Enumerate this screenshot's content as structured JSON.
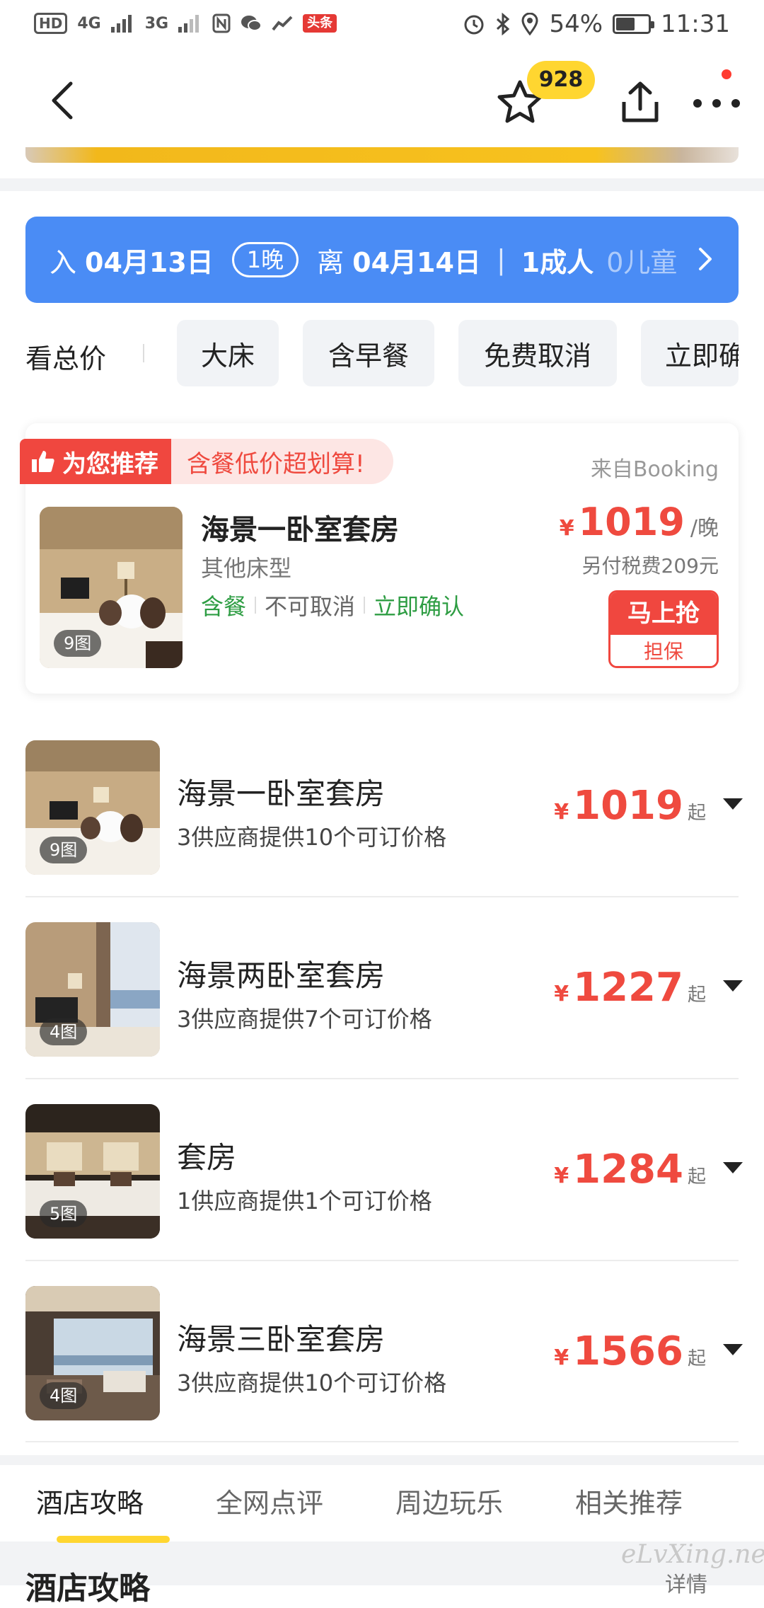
{
  "status_bar": {
    "hd": "HD",
    "sim1": "4G",
    "sim2": "3G",
    "news_badge": "头条",
    "battery_text": "54%",
    "battery_level": 0.54,
    "time": "11:31"
  },
  "nav": {
    "favorite_count": "928"
  },
  "date_bar": {
    "checkin_prefix": "入",
    "checkin_date": "04月13日",
    "nights": "1晚",
    "checkout_prefix": "离",
    "checkout_date": "04月14日",
    "separator": "|",
    "adults": "1成人",
    "children": "0儿童"
  },
  "filters": {
    "total_price_label": "看总价",
    "chips": [
      "大床",
      "含早餐",
      "免费取消",
      "立即确认"
    ]
  },
  "recommended": {
    "tag_label": "为您推荐",
    "tag_note": "含餐低价超划算!",
    "source": "来自Booking",
    "photo_count": "9图",
    "room_name": "海景一卧室套房",
    "bed_type": "其他床型",
    "tag_meal": "含餐",
    "tag_cancel": "不可取消",
    "tag_confirm": "立即确认",
    "currency": "¥",
    "price": "1019",
    "price_unit": "/晚",
    "tax_note": "另付税费209元",
    "book_label": "马上抢",
    "book_sub": "担保"
  },
  "rooms": [
    {
      "photo_count": "9图",
      "name": "海景一卧室套房",
      "suppliers": "3供应商提供10个可订价格",
      "currency": "¥",
      "price": "1019",
      "from": "起"
    },
    {
      "photo_count": "4图",
      "name": "海景两卧室套房",
      "suppliers": "3供应商提供7个可订价格",
      "currency": "¥",
      "price": "1227",
      "from": "起"
    },
    {
      "photo_count": "5图",
      "name": "套房",
      "suppliers": "1供应商提供1个可订价格",
      "currency": "¥",
      "price": "1284",
      "from": "起"
    },
    {
      "photo_count": "4图",
      "name": "海景三卧室套房",
      "suppliers": "3供应商提供10个可订价格",
      "currency": "¥",
      "price": "1566",
      "from": "起"
    }
  ],
  "bottom_tabs": [
    "酒店攻略",
    "全网点评",
    "周边玩乐",
    "相关推荐"
  ],
  "section_peek": "酒店攻略",
  "detail_peek": "详情",
  "watermark": "eLvXing.net",
  "colors": {
    "accent_blue": "#4a8cf5",
    "price_red": "#ef4a3f",
    "badge_yellow": "#ffd630",
    "tag_green": "#2e9d43"
  }
}
